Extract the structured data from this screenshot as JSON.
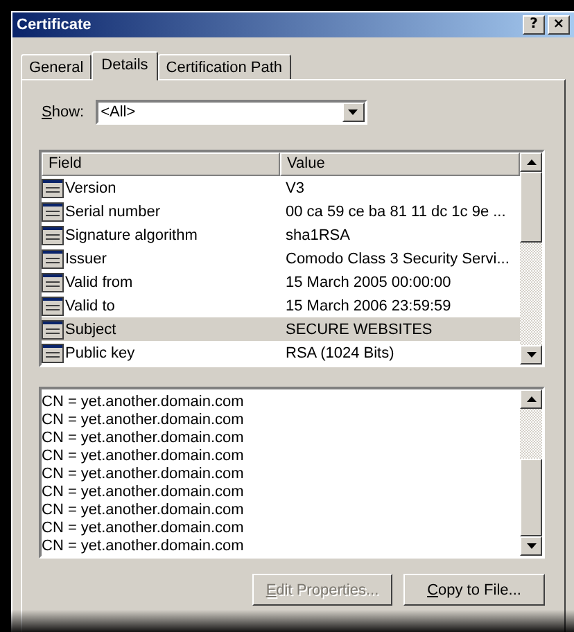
{
  "window": {
    "title": "Certificate",
    "title_buttons": [
      "?",
      "×"
    ]
  },
  "tabs": [
    {
      "label": "General",
      "selected": false
    },
    {
      "label": "Details",
      "selected": true
    },
    {
      "label": "Certification Path",
      "selected": false
    }
  ],
  "show": {
    "label": "Show:",
    "mnemonic_underlined": true,
    "value": "<All>"
  },
  "table": {
    "columns": [
      "Field",
      "Value"
    ],
    "rows": [
      {
        "field": "Version",
        "value": "V3",
        "selected": false
      },
      {
        "field": "Serial number",
        "value": "00 ca 59 ce ba 81 11 dc 1c 9e ...",
        "selected": false
      },
      {
        "field": "Signature algorithm",
        "value": "sha1RSA",
        "selected": false
      },
      {
        "field": "Issuer",
        "value": "Comodo Class 3 Security Servi...",
        "selected": false
      },
      {
        "field": "Valid from",
        "value": "15 March 2005 00:00:00",
        "selected": false
      },
      {
        "field": "Valid to",
        "value": "15 March 2006 23:59:59",
        "selected": false
      },
      {
        "field": "Subject",
        "value": "SECURE WEBSITES",
        "selected": true
      },
      {
        "field": "Public key",
        "value": "RSA (1024 Bits)",
        "selected": false
      }
    ]
  },
  "detail_lines": [
    "CN = yet.another.domain.com",
    "CN = yet.another.domain.com",
    "CN = yet.another.domain.com",
    "CN = yet.another.domain.com",
    "CN = yet.another.domain.com",
    "CN = yet.another.domain.com",
    "CN = yet.another.domain.com",
    "CN = yet.another.domain.com",
    "CN = yet.another.domain.com"
  ],
  "buttons": [
    {
      "label": "Edit Properties...",
      "mnemonic_underlined": true,
      "disabled": true
    },
    {
      "label": "Copy to File...",
      "mnemonic_underlined": true,
      "disabled": false
    }
  ]
}
